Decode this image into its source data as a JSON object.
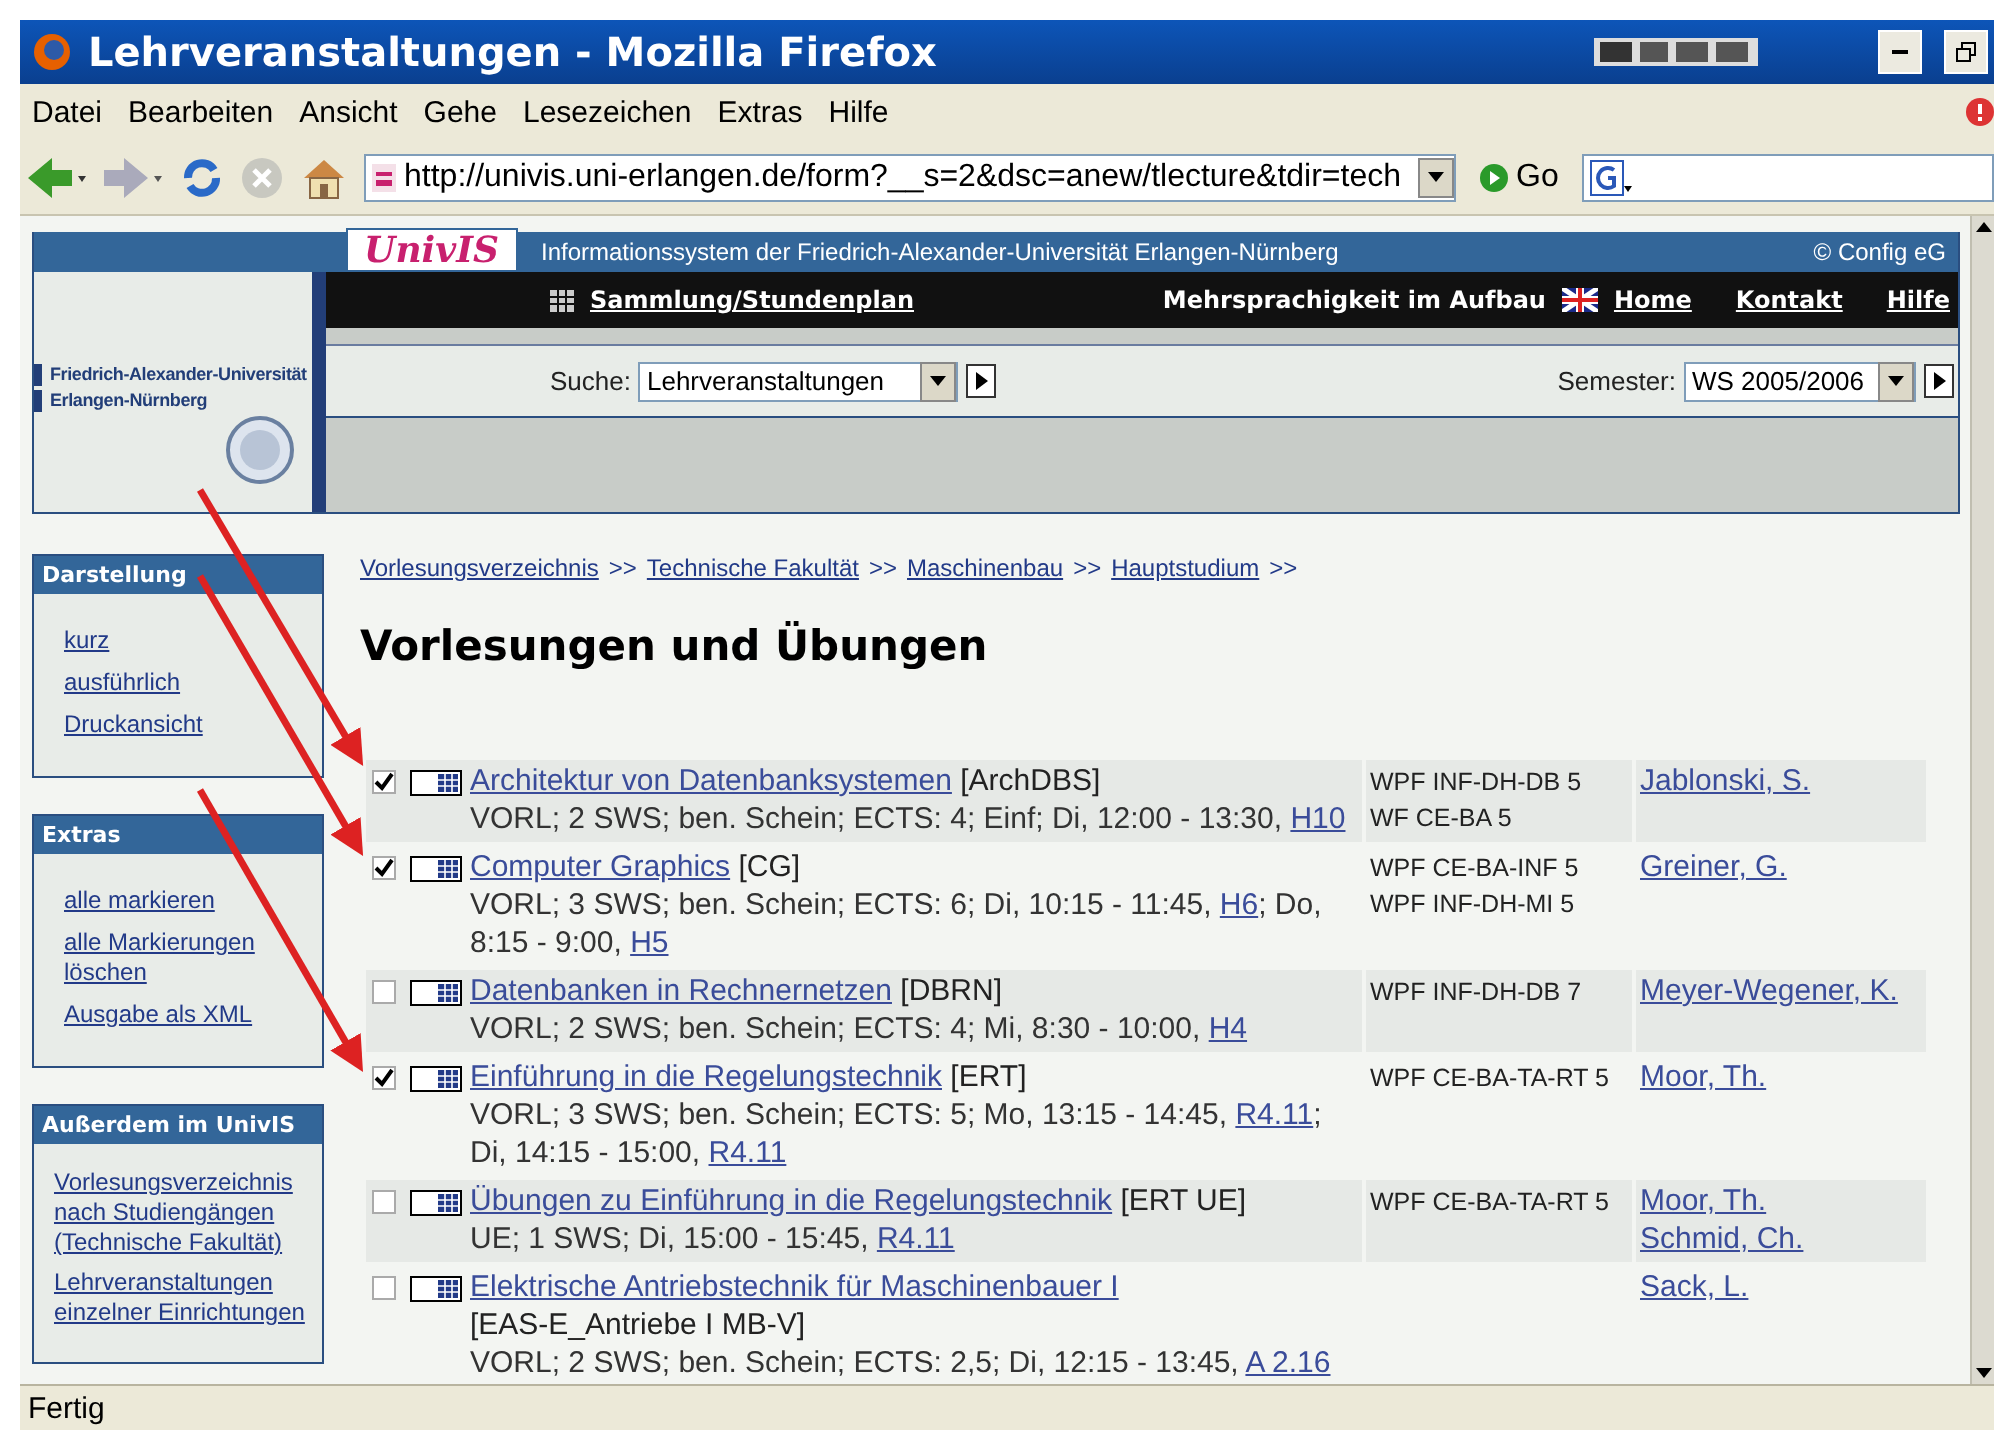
{
  "window": {
    "title": "Lehrveranstaltungen - Mozilla Firefox"
  },
  "menu": [
    "Datei",
    "Bearbeiten",
    "Ansicht",
    "Gehe",
    "Lesezeichen",
    "Extras",
    "Hilfe"
  ],
  "toolbar": {
    "address": "http://univis.uni-erlangen.de/form?__s=2&dsc=anew/tlecture&tdir=tech",
    "go": "Go"
  },
  "header": {
    "logo": "UnivIS",
    "info": "Informationssystem der Friedrich-Alexander-Universität Erlangen-Nürnberg",
    "copyright": "© Config eG",
    "university": [
      "Friedrich-Alexander-Universität",
      "Erlangen-Nürnberg"
    ],
    "nav_link": "Sammlung/Stundenplan",
    "language_note": "Mehrsprachigkeit im Aufbau",
    "links": [
      "Home",
      "Kontakt",
      "Hilfe"
    ],
    "search": {
      "label": "Suche:",
      "value": "Lehrveranstaltungen"
    },
    "semester": {
      "label": "Semester:",
      "value": "WS 2005/2006"
    }
  },
  "sidebar": [
    {
      "title": "Darstellung",
      "links": [
        "kurz",
        "ausführlich",
        "Druckansicht"
      ]
    },
    {
      "title": "Extras",
      "links": [
        "alle markieren",
        "alle Markierungen löschen",
        "Ausgabe als XML"
      ]
    },
    {
      "title": "Außerdem im UnivIS",
      "links": [
        "Vorlesungsverzeichnis nach Studiengängen (Technische Fakultät)",
        "Lehrveranstaltungen einzelner Einrichtungen"
      ]
    }
  ],
  "breadcrumbs": [
    "Vorlesungsverzeichnis",
    "Technische Fakultät",
    "Maschinenbau",
    "Hauptstudium"
  ],
  "breadcrumb_separator": ">>",
  "heading": "Vorlesungen und Übungen",
  "courses": [
    {
      "checked": true,
      "title": "Architektur von Datenbanksystemen",
      "code": "[ArchDBS]",
      "code_wrapped": false,
      "details": [
        [
          {
            "text": "VORL; 2 SWS; ben. Schein; ECTS: 4; Einf; Di, 12:00 - 13:30, "
          },
          {
            "link": "H10"
          }
        ]
      ],
      "modules": [
        "WPF INF-DH-DB 5",
        "WF CE-BA 5"
      ],
      "lecturers": [
        "Jablonski, S."
      ]
    },
    {
      "checked": true,
      "title": "Computer Graphics",
      "code": "[CG]",
      "code_wrapped": false,
      "details": [
        [
          {
            "text": "VORL; 3 SWS; ben. Schein; ECTS: 6; Di, 10:15 - 11:45, "
          },
          {
            "link": "H6"
          },
          {
            "text": "; Do,"
          }
        ],
        [
          {
            "text": "8:15 - 9:00, "
          },
          {
            "link": "H5"
          }
        ]
      ],
      "modules": [
        "WPF CE-BA-INF 5",
        "WPF INF-DH-MI 5"
      ],
      "lecturers": [
        "Greiner, G."
      ]
    },
    {
      "checked": false,
      "title": "Datenbanken in Rechnernetzen",
      "code": "[DBRN]",
      "code_wrapped": false,
      "details": [
        [
          {
            "text": "VORL; 2 SWS; ben. Schein; ECTS: 4; Mi, 8:30 - 10:00, "
          },
          {
            "link": "H4"
          }
        ]
      ],
      "modules": [
        "WPF INF-DH-DB 7"
      ],
      "lecturers": [
        "Meyer-Wegener, K."
      ]
    },
    {
      "checked": true,
      "title": "Einführung in die Regelungstechnik",
      "code": "[ERT]",
      "code_wrapped": false,
      "details": [
        [
          {
            "text": "VORL; 3 SWS; ben. Schein; ECTS: 5; Mo, 13:15 - 14:45, "
          },
          {
            "link": "R4.11"
          },
          {
            "text": ";"
          }
        ],
        [
          {
            "text": "Di, 14:15 - 15:00, "
          },
          {
            "link": "R4.11"
          }
        ]
      ],
      "modules": [
        "WPF CE-BA-TA-RT 5"
      ],
      "lecturers": [
        "Moor, Th."
      ]
    },
    {
      "checked": false,
      "title": "Übungen zu Einführung in die Regelungstechnik",
      "code": "[ERT UE]",
      "code_wrapped": false,
      "details": [
        [
          {
            "text": "UE; 1 SWS; Di, 15:00 - 15:45, "
          },
          {
            "link": "R4.11"
          }
        ]
      ],
      "modules": [
        "WPF CE-BA-TA-RT 5"
      ],
      "lecturers": [
        "Moor, Th.",
        "Schmid, Ch."
      ]
    },
    {
      "checked": false,
      "title": "Elektrische Antriebstechnik für Maschinenbauer I",
      "code": "[EAS-E_Antriebe I MB-V]",
      "code_wrapped": true,
      "details": [
        [
          {
            "text": "VORL; 2 SWS; ben. Schein; ECTS: 2,5; Di, 12:15 - 13:45, "
          },
          {
            "link": "A 2.16"
          }
        ]
      ],
      "lecturers": [
        "Sack, L."
      ]
    }
  ],
  "status_bar": "Fertig"
}
